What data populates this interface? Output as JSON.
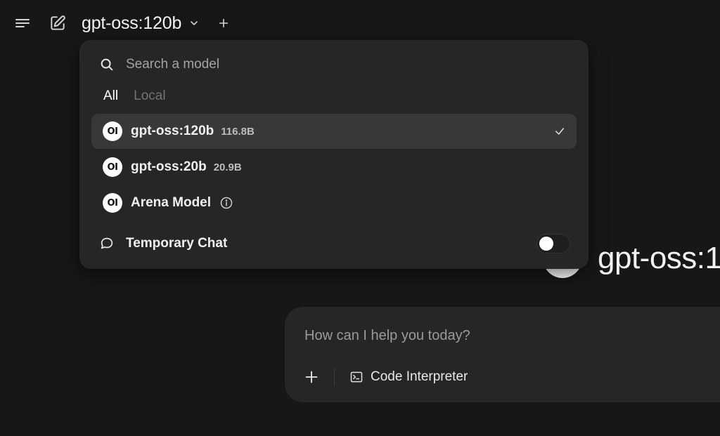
{
  "header": {
    "current_model": "gpt-oss:120b",
    "icons": {
      "menu": "menu-lines-icon",
      "new_chat": "edit-pencil-icon",
      "dropdown": "chevron-down-icon",
      "add": "plus-icon"
    }
  },
  "model_dropdown": {
    "search_placeholder": "Search a model",
    "tabs": [
      {
        "label": "All",
        "active": true
      },
      {
        "label": "Local",
        "active": false
      }
    ],
    "models": [
      {
        "logo": "OI",
        "name": "gpt-oss:120b",
        "size": "116.8B",
        "selected": true
      },
      {
        "logo": "OI",
        "name": "gpt-oss:20b",
        "size": "20.9B",
        "selected": false
      },
      {
        "logo": "OI",
        "name": "Arena Model",
        "size": "",
        "selected": false,
        "info_icon": true
      }
    ],
    "temporary_chat": {
      "label": "Temporary Chat",
      "enabled": false
    }
  },
  "hero": {
    "title": "gpt-oss:1"
  },
  "composer": {
    "placeholder": "How can I help you today?",
    "tool_label": "Code Interpreter"
  },
  "colors": {
    "background": "#171717",
    "panel": "#262626",
    "selected_row": "#383838"
  }
}
